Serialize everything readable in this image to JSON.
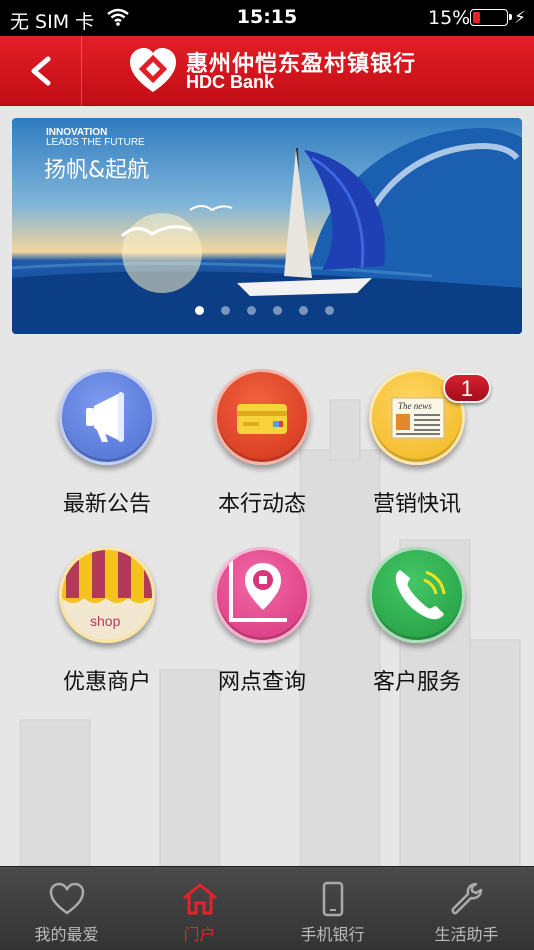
{
  "status": {
    "carrier": "无 SIM 卡",
    "time": "15:15",
    "battery": "15%",
    "battery_level": 0.15
  },
  "header": {
    "bank_name_cn": "惠州仲恺东盈村镇银行",
    "bank_name_en": "HDC Bank",
    "back_icon": "chevron-left-icon"
  },
  "banner": {
    "slogan_en_line1": "INNOVATION",
    "slogan_en_line2": "LEADS THE FUTURE",
    "slogan_cn": "扬帆&起航",
    "slide_count": 6,
    "active_slide": 1
  },
  "menu": [
    {
      "label": "最新公告",
      "icon": "megaphone-icon",
      "color": "#5a7bd8"
    },
    {
      "label": "本行动态",
      "icon": "card-icon",
      "color": "#e6402a"
    },
    {
      "label": "营销快讯",
      "icon": "newspaper-icon",
      "color": "#f6c43a",
      "badge": "1"
    },
    {
      "label": "优惠商户",
      "icon": "shop-icon",
      "color": "#f5c11d"
    },
    {
      "label": "网点查询",
      "icon": "map-pin-icon",
      "color": "#e8438e"
    },
    {
      "label": "客户服务",
      "icon": "phone-icon",
      "color": "#2eae4e"
    }
  ],
  "tabs": [
    {
      "label": "我的最爱",
      "icon": "heart-icon",
      "active": false
    },
    {
      "label": "门户",
      "icon": "home-icon",
      "active": true
    },
    {
      "label": "手机银行",
      "icon": "mobile-icon",
      "active": false
    },
    {
      "label": "生活助手",
      "icon": "wrench-icon",
      "active": false
    }
  ],
  "colors": {
    "brand_red": "#e41e26",
    "tab_active": "#e4222a"
  }
}
